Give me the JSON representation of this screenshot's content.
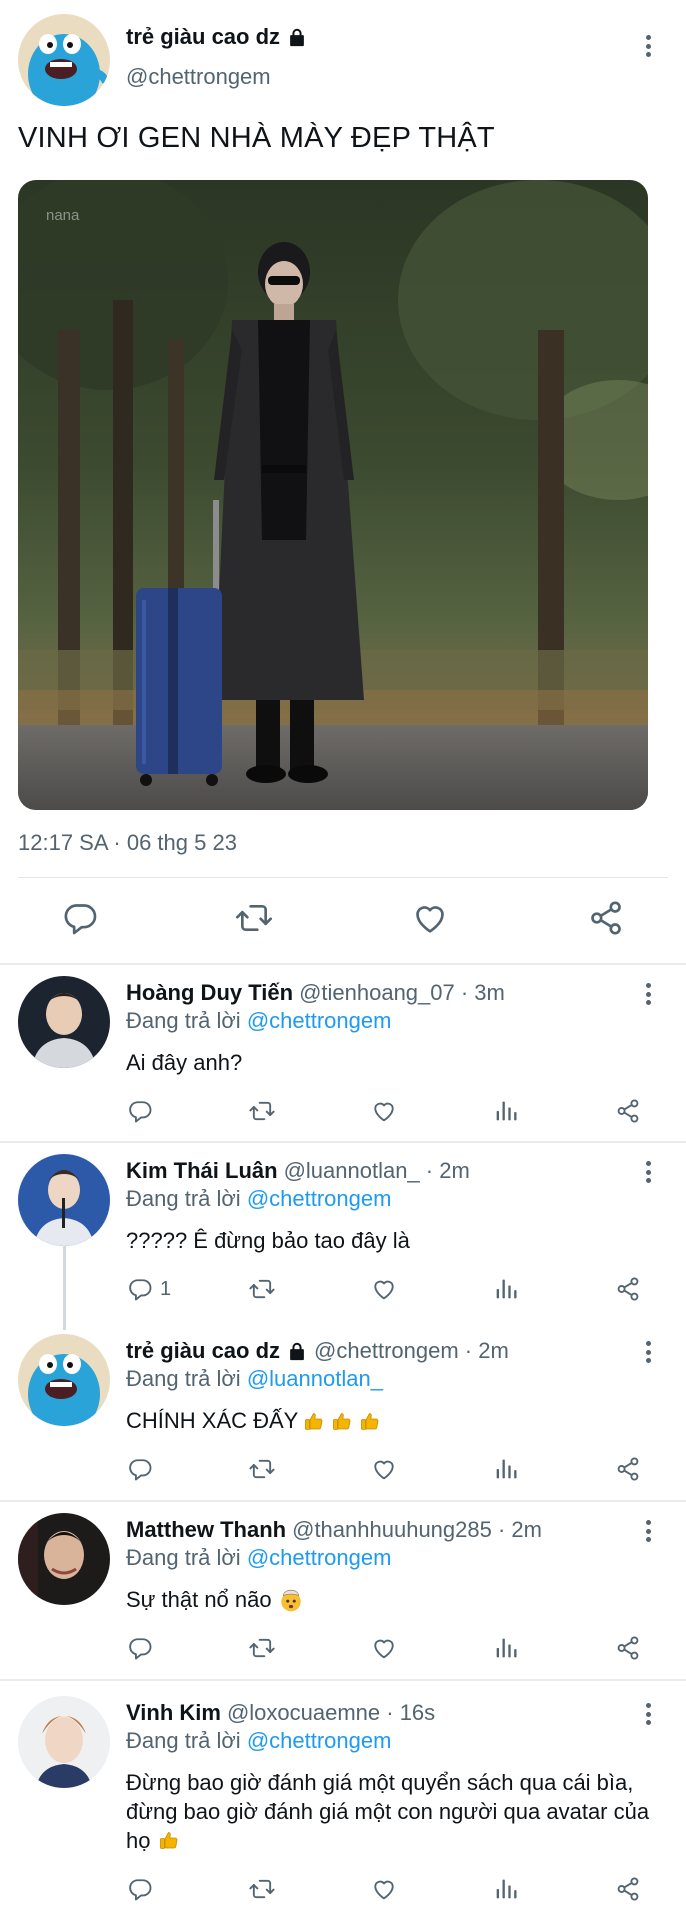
{
  "main_tweet": {
    "author_name": "trẻ giàu cao dz",
    "author_handle": "@chettrongem",
    "text": "VINH ƠI GEN NHÀ MÀY ĐẸP THẬT",
    "photo_watermark": "nana",
    "timestamp": "12:17 SA · 06 thg 5 23",
    "actions": [
      "reply-icon",
      "retweet-icon",
      "like-icon",
      "share-icon"
    ]
  },
  "replies": [
    {
      "name": "Hoàng Duy Tiến",
      "handle": "@tienhoang_07 · 3m",
      "replying_prefix": "Đang trả lời",
      "replying_to": "@chettrongem",
      "text": "Ai đây anh?",
      "reply_count": ""
    },
    {
      "name": "Kim Thái Luân",
      "handle": "@luannotlan_ · 2m",
      "replying_prefix": "Đang trả lời",
      "replying_to": "@chettrongem",
      "text": "????? Ê đừng bảo tao đây là",
      "reply_count": "1"
    },
    {
      "name": "trẻ giàu cao dz",
      "handle": "@chettrongem · 2m",
      "replying_prefix": "Đang trả lời",
      "replying_to": "@luannotlan_",
      "text": "CHÍNH XÁC ĐẤY",
      "reply_count": ""
    },
    {
      "name": "Matthew Thanh",
      "handle": "@thanhhuuhung285 · 2m",
      "replying_prefix": "Đang trả lời",
      "replying_to": "@chettrongem",
      "text": "Sự thật nổ não",
      "reply_count": ""
    },
    {
      "name": "Vinh Kim",
      "handle": "@loxocuaemne · 16s",
      "replying_prefix": "Đang trả lời",
      "replying_to": "@chettrongem",
      "text": "Đừng bao giờ đánh giá một quyển sách qua cái bìa, đừng bao giờ đánh giá một con người qua avatar của họ",
      "reply_count": ""
    }
  ],
  "colors": {
    "text": "#0f1419",
    "secondary": "#536471",
    "mention": "#1d9bf0",
    "divider": "#e1e6ea"
  }
}
